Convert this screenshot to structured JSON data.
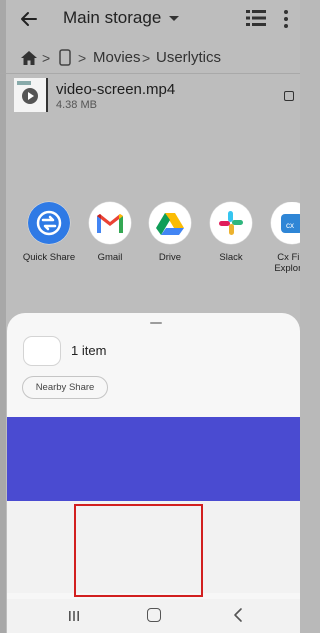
{
  "app": {
    "title": "Main storage",
    "breadcrumbs": [
      "Movies",
      "Userlytics"
    ],
    "file": {
      "name": "video-screen.mp4",
      "size": "4.38 MB"
    }
  },
  "share_sheet": {
    "item_count": "1 item",
    "nearby_share": "Nearby Share",
    "apps": [
      {
        "label": "Quick Share",
        "icon": "quick-share-icon"
      },
      {
        "label": "Gmail",
        "icon": "gmail-icon"
      },
      {
        "label": "Drive",
        "icon": "drive-icon"
      },
      {
        "label": "Slack",
        "icon": "slack-icon"
      },
      {
        "label": "Cx File Explorer",
        "icon": "cx-file-explorer-icon"
      }
    ],
    "highlight_color": "#d21f1f",
    "preview_color": "#4a4bd1"
  }
}
